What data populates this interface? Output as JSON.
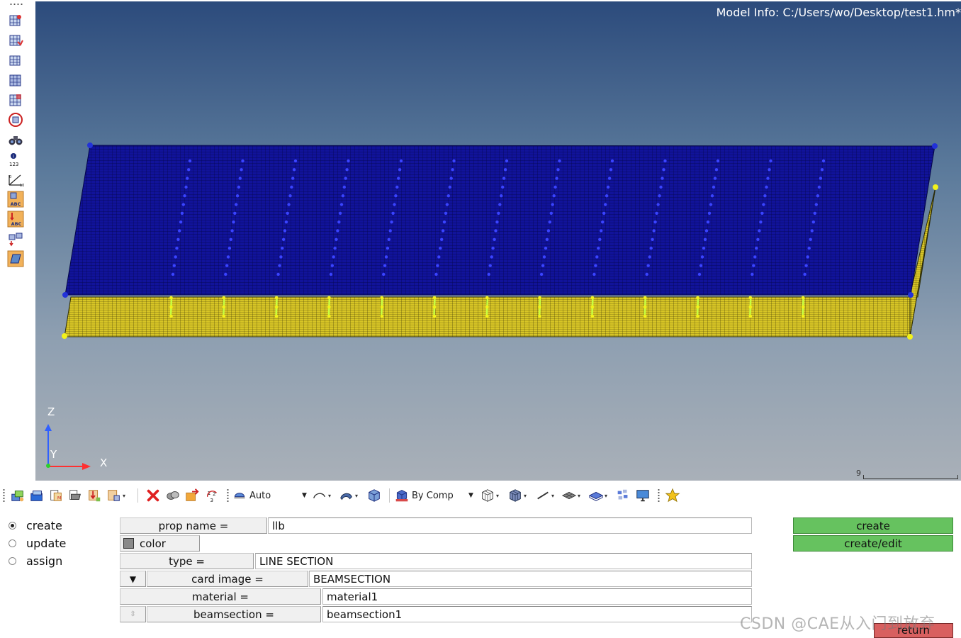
{
  "viewport": {
    "model_info": "Model Info: C:/Users/wo/Desktop/test1.hm*",
    "axes": {
      "z": "Z",
      "y": "Y",
      "x": "X"
    },
    "scale_value": "9"
  },
  "toolbar": {
    "visualization_combo": "Auto",
    "color_mode_combo": "By Comp"
  },
  "panel": {
    "radios": [
      {
        "label": "create",
        "checked": true
      },
      {
        "label": "update",
        "checked": false
      },
      {
        "label": "assign",
        "checked": false
      }
    ],
    "fields": {
      "prop_name_label": "prop name =",
      "prop_name_value": "llb",
      "color_label": "color",
      "type_label": "type =",
      "type_value": "LINE SECTION",
      "card_image_label": "card image =",
      "card_image_value": "BEAMSECTION",
      "material_label": "material =",
      "material_value": "material1",
      "beamsection_label": "beamsection =",
      "beamsection_value": "beamsection1"
    },
    "buttons": {
      "create": "create",
      "create_edit": "create/edit",
      "return": "return"
    }
  },
  "watermark": "CSDN @CAE从入门到放弃",
  "colors": {
    "top_plate": "#11139a",
    "bottom_plate": "#d7c526",
    "beam": "#c8ff40",
    "create_button": "#66c25f",
    "return_button": "#d86060"
  }
}
